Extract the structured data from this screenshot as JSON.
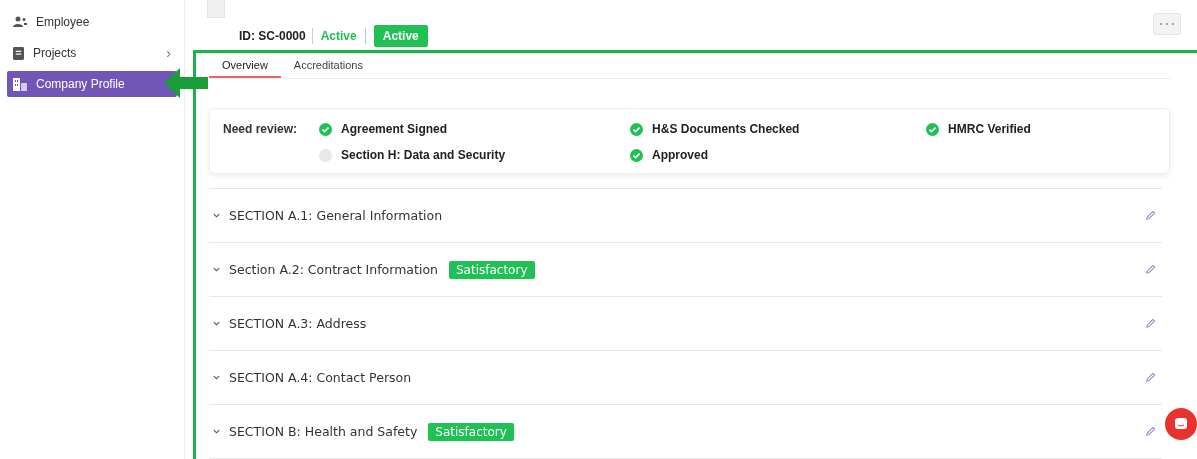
{
  "sidebar": {
    "items": [
      {
        "label": "Employee",
        "kind": "people",
        "selected": false
      },
      {
        "label": "Projects",
        "kind": "document",
        "selected": false,
        "chevron": "›"
      },
      {
        "label": "Company Profile",
        "kind": "building",
        "selected": true
      }
    ]
  },
  "header": {
    "id": "ID: SC-0000",
    "status_text": "Active",
    "status_badge": "Active"
  },
  "tabs": [
    {
      "label": "Overview",
      "selected": true
    },
    {
      "label": "Accreditations",
      "selected": false
    }
  ],
  "review": {
    "label": "Need review:",
    "items": [
      {
        "label": "Agreement Signed",
        "checked": true
      },
      {
        "label": "H&S Documents Checked",
        "checked": true
      },
      {
        "label": "HMRC Verified",
        "checked": true
      },
      {
        "label": "Section H: Data and Security",
        "checked": false
      },
      {
        "label": "Approved",
        "checked": true
      }
    ]
  },
  "sections": [
    {
      "title": "SECTION A.1: General Information"
    },
    {
      "title": "Section A.2: Contract Information",
      "badge": "Satisfactory"
    },
    {
      "title": "SECTION A.3: Address"
    },
    {
      "title": "SECTION A.4: Contact Person"
    },
    {
      "title": "SECTION B: Health and Safety",
      "badge": "Satisfactory"
    }
  ]
}
